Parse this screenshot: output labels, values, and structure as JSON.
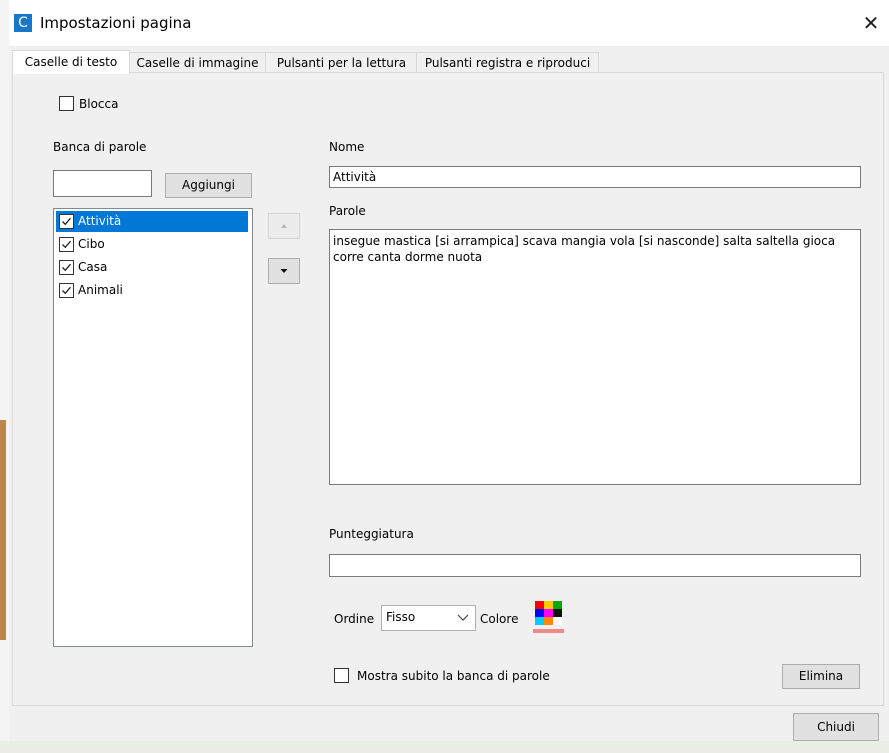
{
  "window": {
    "title": "Impostazioni pagina",
    "app_icon_letter": "C",
    "close_glyph": "✕"
  },
  "tabs": [
    {
      "label": "Caselle di testo",
      "active": true
    },
    {
      "label": "Caselle di immagine",
      "active": false
    },
    {
      "label": "Pulsanti per la lettura",
      "active": false
    },
    {
      "label": "Pulsanti registra e riproduci",
      "active": false
    }
  ],
  "lock": {
    "label": "Blocca",
    "checked": false
  },
  "word_bank": {
    "label": "Banca di parole",
    "input_value": "",
    "add_label": "Aggiungi",
    "items": [
      {
        "label": "Attività",
        "checked": true,
        "selected": true
      },
      {
        "label": "Cibo",
        "checked": true,
        "selected": false
      },
      {
        "label": "Casa",
        "checked": true,
        "selected": false
      },
      {
        "label": "Animali",
        "checked": true,
        "selected": false
      }
    ]
  },
  "details": {
    "name_label": "Nome",
    "name_value": "Attività",
    "words_label": "Parole",
    "words_value": "insegue mastica [si arrampica] scava mangia vola [si nasconde] salta saltella gioca corre canta dorme nuota",
    "punctuation_label": "Punteggiatura",
    "punctuation_value": "",
    "order_label": "Ordine",
    "order_value": "Fisso",
    "color_label": "Colore",
    "show_bank_label": "Mostra subito la banca di parole",
    "show_bank_checked": false,
    "delete_label": "Elimina"
  },
  "footer": {
    "close_label": "Chiudi"
  },
  "colors": {
    "selection": "#0078d7",
    "app_icon": "#1877c9",
    "swatch": [
      "#ff0000",
      "#ffcc00",
      "#00aa00",
      "#0000ff",
      "#ff00ff",
      "#111111",
      "#00ccff",
      "#ff8800",
      "#ffffff"
    ],
    "swatch_underline": "#f08a8a"
  }
}
